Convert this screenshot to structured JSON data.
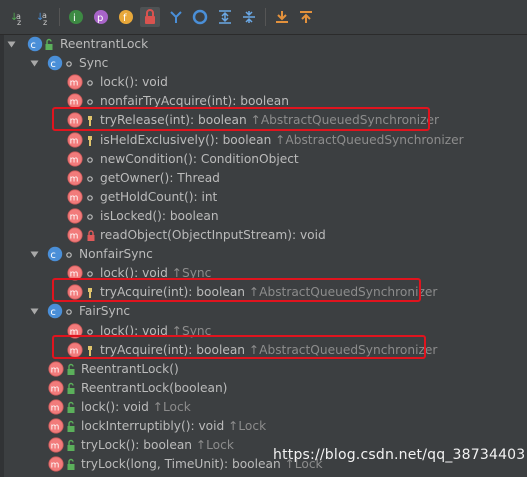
{
  "toolbar": [
    {
      "name": "sort-visibility-icon"
    },
    {
      "name": "sort-alpha-icon"
    },
    {
      "name": "show-inherited-icon"
    },
    {
      "name": "show-properties-icon"
    },
    {
      "name": "show-fields-icon"
    },
    {
      "name": "show-non-public-icon"
    },
    {
      "name": "show-lambdas-icon"
    },
    {
      "name": "autoscroll-icon"
    },
    {
      "name": "expand-all-icon"
    },
    {
      "name": "collapse-all-icon"
    },
    {
      "name": "autoscroll-to-source-icon"
    },
    {
      "name": "autoscroll-from-source-icon"
    }
  ],
  "tree": {
    "root": "ReentrantLock",
    "rows": [
      {
        "sig": "ReentrantLock",
        "inh": ""
      },
      {
        "sig": "Sync",
        "inh": ""
      },
      {
        "sig": "lock(): void",
        "inh": ""
      },
      {
        "sig": "nonfairTryAcquire(int): boolean",
        "inh": ""
      },
      {
        "sig": "tryRelease(int): boolean",
        "inh": "↑AbstractQueuedSynchronizer"
      },
      {
        "sig": "isHeldExclusively(): boolean",
        "inh": "↑AbstractQueuedSynchronizer"
      },
      {
        "sig": "newCondition(): ConditionObject",
        "inh": ""
      },
      {
        "sig": "getOwner(): Thread",
        "inh": ""
      },
      {
        "sig": "getHoldCount(): int",
        "inh": ""
      },
      {
        "sig": "isLocked(): boolean",
        "inh": ""
      },
      {
        "sig": "readObject(ObjectInputStream): void",
        "inh": ""
      },
      {
        "sig": "NonfairSync",
        "inh": ""
      },
      {
        "sig": "lock(): void",
        "inh": "↑Sync"
      },
      {
        "sig": "tryAcquire(int): boolean",
        "inh": "↑AbstractQueuedSynchronizer"
      },
      {
        "sig": "FairSync",
        "inh": ""
      },
      {
        "sig": "lock(): void",
        "inh": "↑Sync"
      },
      {
        "sig": "tryAcquire(int): boolean",
        "inh": "↑AbstractQueuedSynchronizer"
      },
      {
        "sig": "ReentrantLock()",
        "inh": ""
      },
      {
        "sig": "ReentrantLock(boolean)",
        "inh": ""
      },
      {
        "sig": "lock(): void",
        "inh": "↑Lock"
      },
      {
        "sig": "lockInterruptibly(): void",
        "inh": "↑Lock"
      },
      {
        "sig": "tryLock(): boolean",
        "inh": "↑Lock"
      },
      {
        "sig": "tryLock(long, TimeUnit): boolean",
        "inh": "↑Lock"
      }
    ]
  },
  "watermark": "https://blog.csdn.net/qq_38734403",
  "colors": {
    "background": "#3c3f41",
    "text": "#bbbbbb",
    "inherited_text": "#8c8c8c",
    "highlight_border": "#e0141e",
    "method_icon": "#f27b7b",
    "class_icon": "#4a8fd8"
  }
}
